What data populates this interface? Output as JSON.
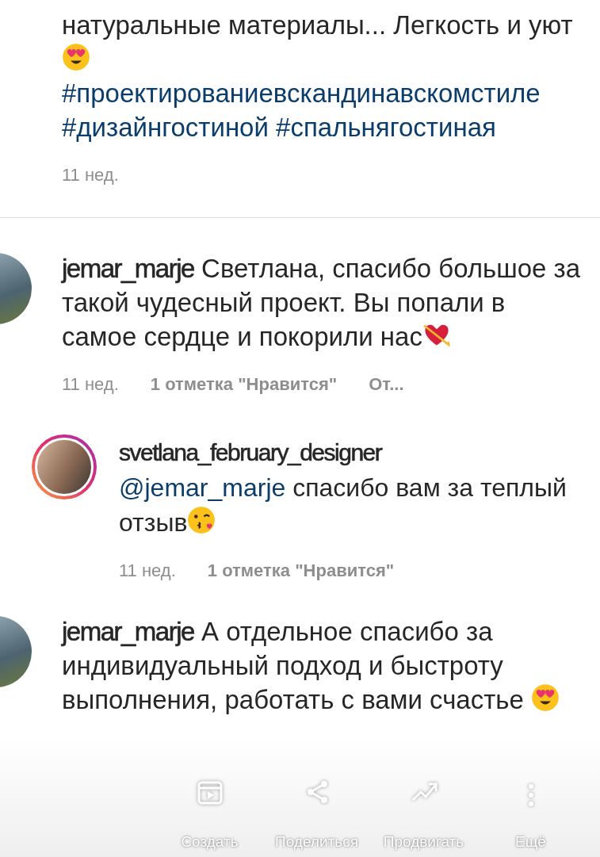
{
  "caption": {
    "text": "натуральные материалы... Легкость и уют",
    "hashtags": [
      "#проектированиевскандинавскомстиле",
      "#дизайнгостиной",
      "#спальнягостиная"
    ],
    "time": "11 нед."
  },
  "comments": [
    {
      "username": "jemar_marje",
      "text": "Светлана, спасибо большое за такой чудесный проект. Вы попали в самое сердце и покорили нас",
      "time": "11 нед.",
      "likes": "1 отметка \"Нравится\"",
      "reply": "От...",
      "replies": [
        {
          "username": "svetlana_february_designer",
          "mention": "@jemar_marje",
          "text": "спасибо вам за теплый отзыв",
          "time": "11 нед.",
          "likes": "1 отметка \"Нравится\""
        }
      ]
    },
    {
      "username": "jemar_marje",
      "text": "А отдельное спасибо за индивидуальный подход и быстроту выполнения, работать с вами счастье "
    }
  ],
  "action_bar": [
    {
      "label": "Создать"
    },
    {
      "label": "Поделиться"
    },
    {
      "label": "Продвигать"
    },
    {
      "label": "Ещё"
    }
  ]
}
